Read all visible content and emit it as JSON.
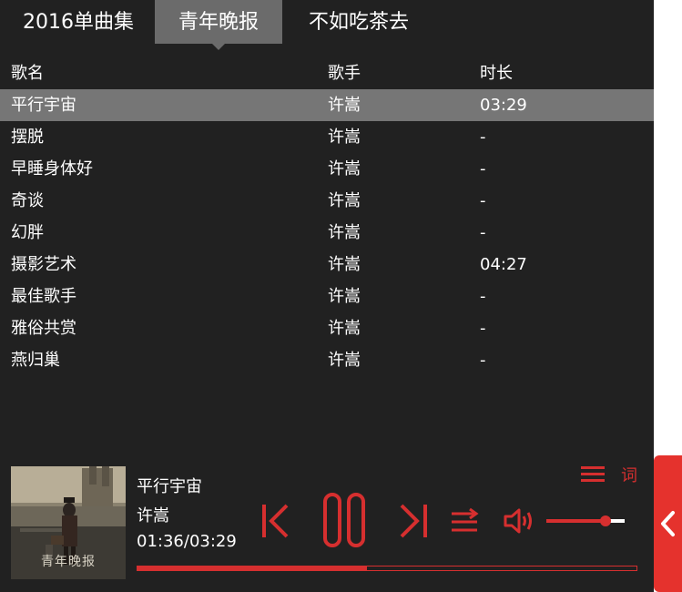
{
  "tabs": [
    {
      "label": "2016单曲集"
    },
    {
      "label": "青年晚报"
    },
    {
      "label": "不如吃茶去"
    }
  ],
  "active_tab": 1,
  "table": {
    "headers": {
      "title": "歌名",
      "artist": "歌手",
      "duration": "时长"
    },
    "rows": [
      {
        "title": "平行宇宙",
        "artist": "许嵩",
        "duration": "03:29"
      },
      {
        "title": "摆脱",
        "artist": "许嵩",
        "duration": "-"
      },
      {
        "title": "早睡身体好",
        "artist": "许嵩",
        "duration": "-"
      },
      {
        "title": "奇谈",
        "artist": "许嵩",
        "duration": "-"
      },
      {
        "title": "幻胖",
        "artist": "许嵩",
        "duration": "-"
      },
      {
        "title": "摄影艺术",
        "artist": "许嵩",
        "duration": "04:27"
      },
      {
        "title": "最佳歌手",
        "artist": "许嵩",
        "duration": "-"
      },
      {
        "title": "雅俗共赏",
        "artist": "许嵩",
        "duration": "-"
      },
      {
        "title": "燕归巢",
        "artist": "许嵩",
        "duration": "-"
      }
    ],
    "selected_row": 0
  },
  "player": {
    "cover_caption": "青年晚报",
    "title": "平行宇宙",
    "artist": "许嵩",
    "time": "01:36/03:29",
    "progress": 0.46,
    "volume": 0.75,
    "lyric_label": "词",
    "accent_color": "#d62f2f",
    "icons": {
      "prev": "skip-previous-icon",
      "play_pause": "pause-icon",
      "next": "skip-next-icon",
      "mode": "shuffle-icon",
      "volume": "volume-icon",
      "playlist": "playlist-icon",
      "collapse": "chevron-left-icon"
    }
  }
}
